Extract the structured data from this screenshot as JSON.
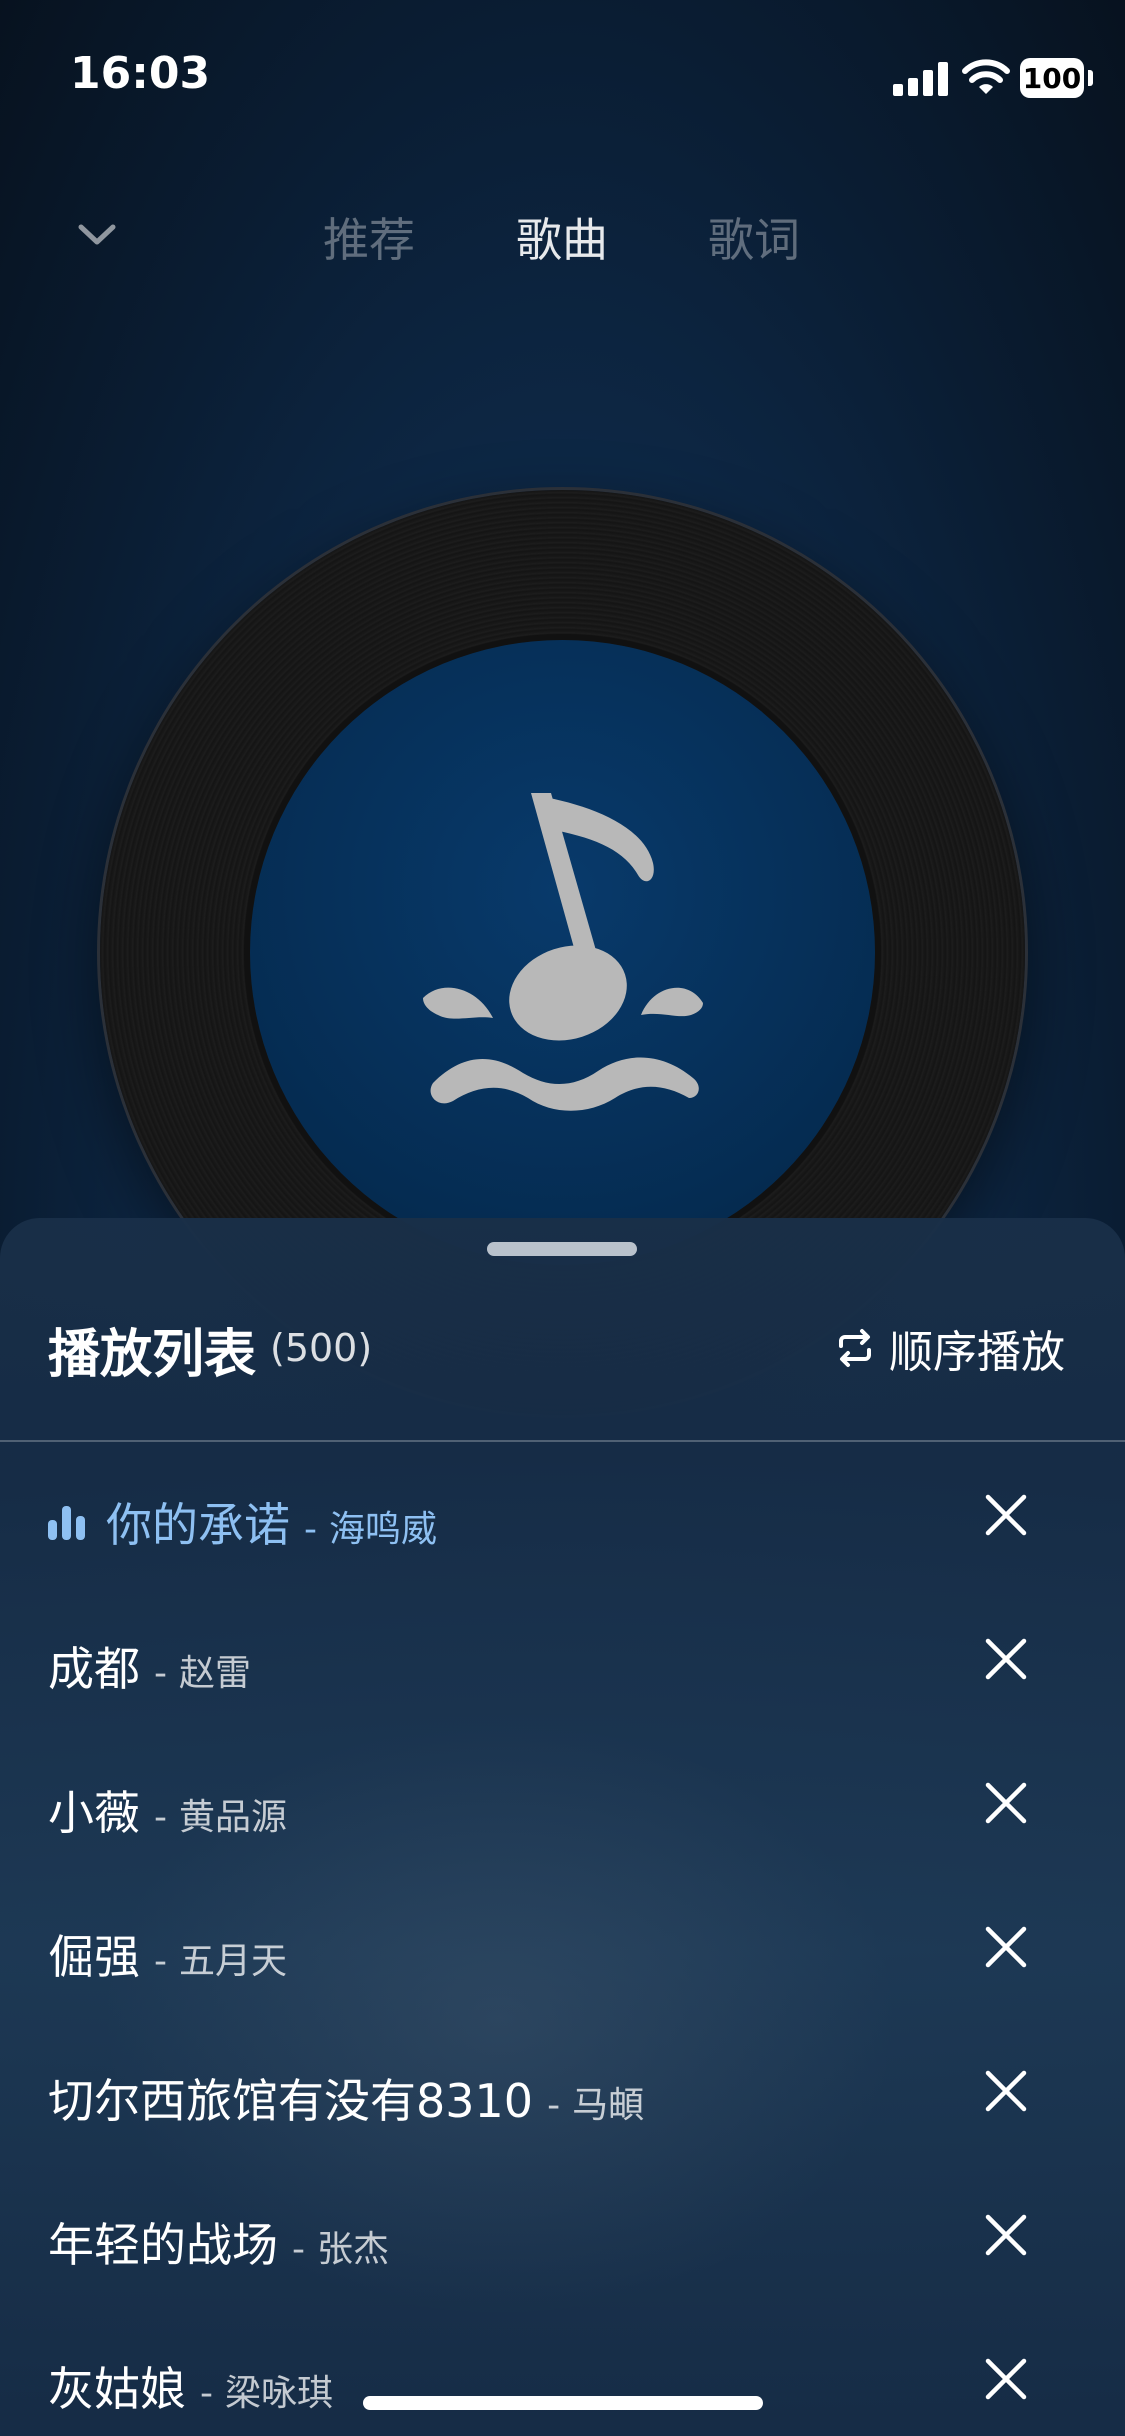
{
  "status_bar": {
    "time": "16:03",
    "battery": "100"
  },
  "tabs": [
    {
      "label": "推荐",
      "active": false
    },
    {
      "label": "歌曲",
      "active": true
    },
    {
      "label": "歌词",
      "active": false
    }
  ],
  "playlist": {
    "title": "播放列表",
    "count": "(500)",
    "play_mode": "顺序播放",
    "items": [
      {
        "title": "你的承诺",
        "sep": "-",
        "artist": "海鸣威",
        "playing": true
      },
      {
        "title": "成都",
        "sep": "-",
        "artist": "赵雷"
      },
      {
        "title": "小薇",
        "sep": "-",
        "artist": "黄品源"
      },
      {
        "title": "倔强",
        "sep": "-",
        "artist": "五月天"
      },
      {
        "title": "切尔西旅馆有没有8310",
        "sep": "-",
        "artist": "马頔"
      },
      {
        "title": "年轻的战场",
        "sep": "-",
        "artist": "张杰"
      },
      {
        "title": "灰姑娘",
        "sep": "-",
        "artist": "梁咏琪"
      }
    ]
  },
  "colors": {
    "accent": "#8ec0f2",
    "vinyl_label": "#052c52"
  },
  "icons": [
    "chevron-down-icon",
    "music-note-icon",
    "repeat-icon",
    "equalizer-icon",
    "close-icon"
  ]
}
